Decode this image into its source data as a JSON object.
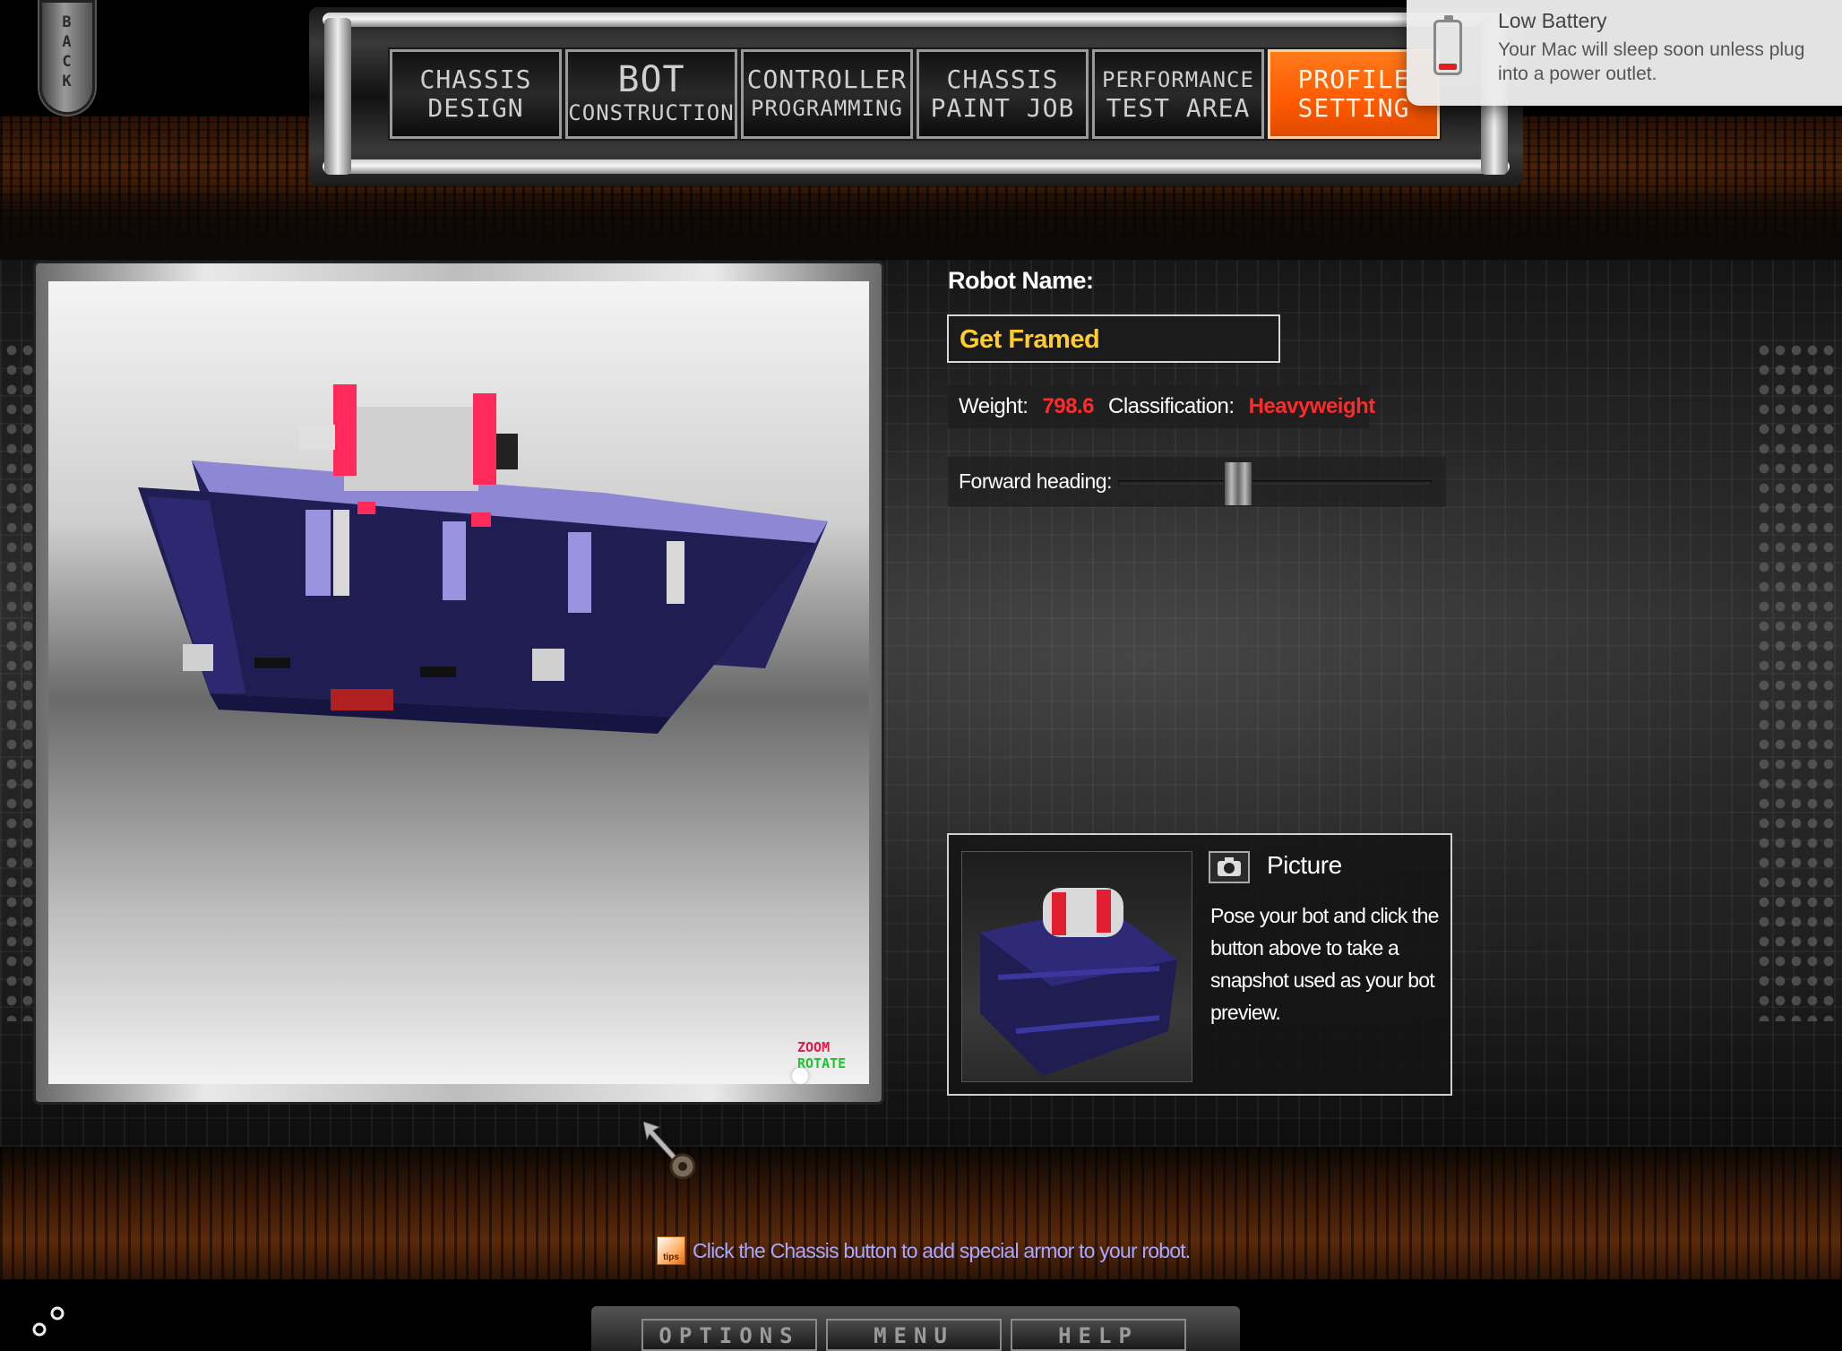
{
  "back_button": {
    "label": "BACK"
  },
  "nav_tabs": [
    {
      "line1": "CHASSIS",
      "line2": "DESIGN"
    },
    {
      "line1": "BOT",
      "line2": "CONSTRUCTION"
    },
    {
      "line1": "CONTROLLER",
      "line2": "PROGRAMMING"
    },
    {
      "line1": "CHASSIS",
      "line2": "PAINT JOB"
    },
    {
      "line1": "PERFORMANCE",
      "line2": "TEST AREA"
    },
    {
      "line1": "PROFILE",
      "line2": "SETTING"
    }
  ],
  "active_tab": "PROFILE SETTING",
  "notification": {
    "title": "Low Battery",
    "body_line1": "Your Mac will sleep soon unless plug",
    "body_line2": "into a power outlet.",
    "battery_level": 0.12
  },
  "viewport": {
    "zoom_hint": "ZOOM",
    "rotate_hint": "ROTATE"
  },
  "profile": {
    "robot_name_label": "Robot Name:",
    "robot_name_value": "Get Framed",
    "weight_label": "Weight:",
    "weight_value": "798.6",
    "classification_label": "Classification:",
    "classification_value": "Heavyweight",
    "heading_label": "Forward heading:",
    "heading_level": 0.38
  },
  "picture": {
    "title": "Picture",
    "description": "Pose your bot and click the button above to take a snapshot used as your bot preview."
  },
  "tip": {
    "icon_text": "tips",
    "text": "Click the Chassis button to add special armor to your robot."
  },
  "bottom_nav": {
    "options": "OPTIONS",
    "menu": "MENU",
    "help": "HELP"
  },
  "colors": {
    "accent_orange": "#ff5a00",
    "name_yellow": "#ffcc2a",
    "stat_red": "#ff2a2a",
    "tip_blue": "#a9a6ff",
    "robot_navy": "#1f1d52"
  }
}
